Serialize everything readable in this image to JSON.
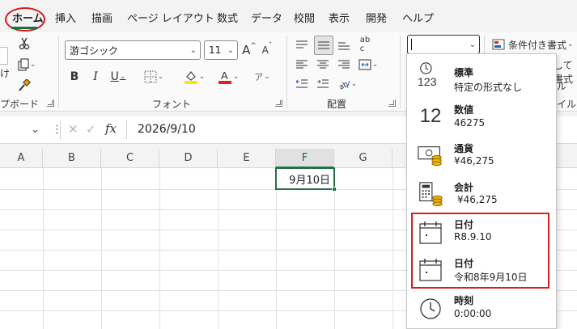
{
  "tabs": [
    "ホーム",
    "挿入",
    "描画",
    "ページ レイアウト",
    "数式",
    "データ",
    "校閲",
    "表示",
    "開発",
    "ヘルプ"
  ],
  "ribbon": {
    "clipboard_label": "プボード",
    "clipboard_partial": "け",
    "font_label": "フォント",
    "font_name": "游ゴシック",
    "font_size": "11",
    "align_label": "配置",
    "number_format_value": "",
    "conditional_format": "条件付き書式",
    "partial_right_1": "して書式",
    "partial_right_2": "ル",
    "partial_right_3": "イル"
  },
  "formula_bar": {
    "value": "2026/9/10",
    "fx": "fx"
  },
  "grid": {
    "columns": [
      "A",
      "B",
      "C",
      "D",
      "E",
      "F",
      "G"
    ],
    "active_cell_value": "9月10日"
  },
  "format_options": [
    {
      "title": "標準",
      "sub": "特定の形式なし",
      "icon": "general-icon",
      "icon_text": "123"
    },
    {
      "title": "数値",
      "sub": "46275",
      "icon": "number-icon",
      "icon_text": "12"
    },
    {
      "title": "通貨",
      "sub": "¥46,275",
      "icon": "currency-icon"
    },
    {
      "title": "会計",
      "sub": "¥46,275",
      "icon": "accounting-icon"
    },
    {
      "title": "日付",
      "sub": "R8.9.10",
      "icon": "short-date-icon"
    },
    {
      "title": "日付",
      "sub": "令和8年9月10日",
      "icon": "long-date-icon"
    },
    {
      "title": "時刻",
      "sub": "0:00:00",
      "icon": "time-icon"
    }
  ],
  "colors": {
    "accent": "#217346",
    "highlight_red": "#d42020",
    "font_red": "#e0201c",
    "highlight_yellow": "#ffe600"
  }
}
